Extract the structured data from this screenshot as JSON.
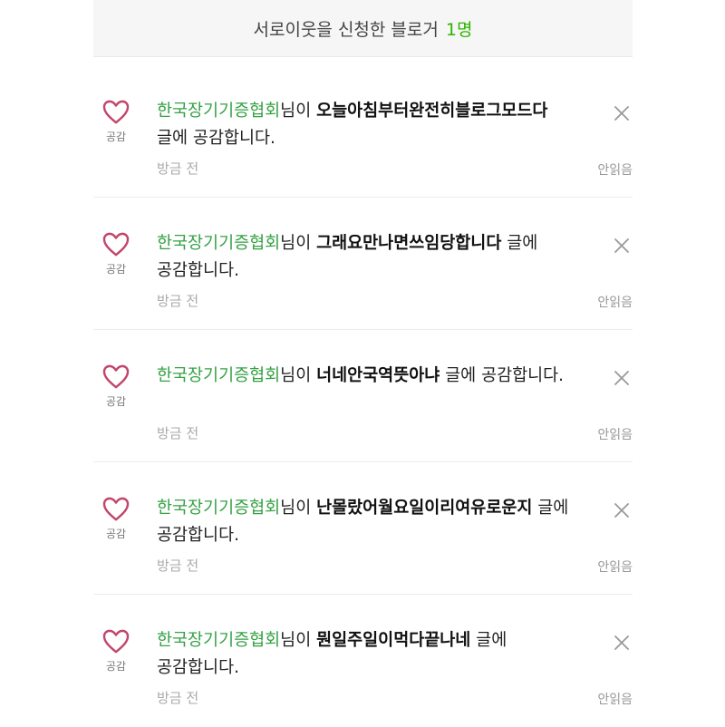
{
  "header": {
    "title": "서로이웃을 신청한 블로거",
    "count": "1명"
  },
  "items": [
    {
      "like_label": "공감",
      "blog": "한국장기기증협회",
      "connector": "님이 ",
      "post": "오늘아침부터완전히블로그모드다",
      "suffix": " 글에 공감합니다.",
      "time": "방금 전",
      "unread": "안읽음"
    },
    {
      "like_label": "공감",
      "blog": "한국장기기증협회",
      "connector": "님이 ",
      "post": "그래요만나면쓰임당합니다",
      "suffix": " 글에 공감합니다.",
      "time": "방금 전",
      "unread": "안읽음"
    },
    {
      "like_label": "공감",
      "blog": "한국장기기증협회",
      "connector": "님이 ",
      "post": "너네안국역뜻아냐",
      "suffix": " 글에 공감합니다.",
      "time": "방금 전",
      "unread": "안읽음"
    },
    {
      "like_label": "공감",
      "blog": "한국장기기증협회",
      "connector": "님이 ",
      "post": "난몰랐어월요일이리여유로운지",
      "suffix": " 글에 공감합니다.",
      "time": "방금 전",
      "unread": "안읽음"
    },
    {
      "like_label": "공감",
      "blog": "한국장기기증협회",
      "connector": "님이 ",
      "post": "뭔일주일이먹다끝나네",
      "suffix": " 글에 공감합니다.",
      "time": "방금 전",
      "unread": "안읽음"
    }
  ],
  "icons": {
    "like": "heart-outline-icon",
    "close": "close-icon"
  },
  "colors": {
    "blog_name": "#35a244",
    "count": "#2db400",
    "heart": "#c2456a"
  }
}
